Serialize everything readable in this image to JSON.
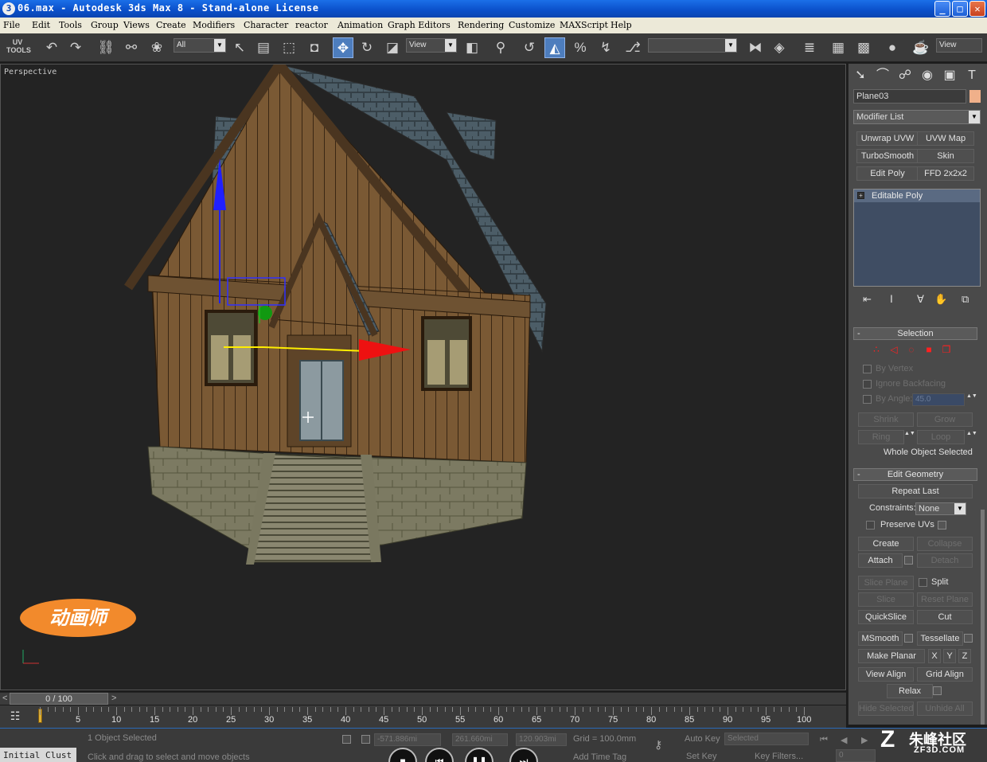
{
  "window": {
    "title": "06.max  -  Autodesk 3ds Max 8   -  Stand-alone License",
    "app_icon": "3",
    "minimize": "_",
    "maximize": "□",
    "close": "✕"
  },
  "menu": [
    "File",
    "Edit",
    "Tools",
    "Group",
    "Views",
    "Create",
    "Modifiers",
    "Character",
    "reactor",
    "Animation",
    "Graph Editors",
    "Rendering",
    "Customize",
    "MAXScript",
    "Help"
  ],
  "toolbar": {
    "uv_tools": "UV\nTOOLS",
    "selection_filter": "All",
    "ref_coord": "View",
    "named_sel": "",
    "view_right": "View"
  },
  "viewport": {
    "label": "Perspective",
    "logo_text": "动画师"
  },
  "command_panel": {
    "object_name": "Plane03",
    "modifier_list": "Modifier List",
    "modifier_buttons": [
      "Unwrap UVW",
      "UVW Map",
      "TurboSmooth",
      "Skin",
      "Edit Poly",
      "FFD 2x2x2"
    ],
    "stack_items": [
      "Editable Poly"
    ],
    "selection": {
      "title": "Selection",
      "by_vertex": "By Vertex",
      "ignore_backfacing": "Ignore Backfacing",
      "by_angle": "By Angle:",
      "angle_value": "45.0",
      "shrink": "Shrink",
      "grow": "Grow",
      "ring": "Ring",
      "loop": "Loop",
      "status": "Whole Object Selected"
    },
    "edit_geometry": {
      "title": "Edit Geometry",
      "repeat_last": "Repeat Last",
      "constraints_label": "Constraints:",
      "constraints_value": "None",
      "preserve_uvs": "Preserve UVs",
      "create": "Create",
      "collapse": "Collapse",
      "attach": "Attach",
      "detach": "Detach",
      "slice_plane": "Slice Plane",
      "split": "Split",
      "slice": "Slice",
      "reset_plane": "Reset Plane",
      "quickslice": "QuickSlice",
      "cut": "Cut",
      "msmooth": "MSmooth",
      "tessellate": "Tessellate",
      "make_planar": "Make Planar",
      "x": "X",
      "y": "Y",
      "z": "Z",
      "view_align": "View Align",
      "grid_align": "Grid Align",
      "relax": "Relax",
      "hide_selected": "Hide Selected",
      "unhide_all": "Unhide All"
    }
  },
  "timeline": {
    "frame_display": "0 / 100",
    "prev": "<",
    "next": ">",
    "ticks": [
      "5",
      "10",
      "15",
      "20",
      "25",
      "30",
      "35",
      "40",
      "45",
      "50",
      "55",
      "60",
      "65",
      "70",
      "75",
      "80",
      "85",
      "90",
      "95",
      "100"
    ]
  },
  "status": {
    "selected": "1 Object Selected",
    "prompt": "Click and drag to select and move objects",
    "x_value": "-571.886mi",
    "y_value": "261.660mi",
    "z_value": "120.903mi",
    "grid": "Grid = 100.0mm",
    "add_time_tag": "Add Time Tag",
    "auto_key": "Auto Key",
    "selected_filter": "Selected",
    "set_key": "Set Key",
    "key_filters": "Key Filters...",
    "frame_field": "0",
    "script_label": "Initial Clust"
  },
  "watermark": {
    "cn": "朱峰社区",
    "url": "ZF3D.COM"
  }
}
